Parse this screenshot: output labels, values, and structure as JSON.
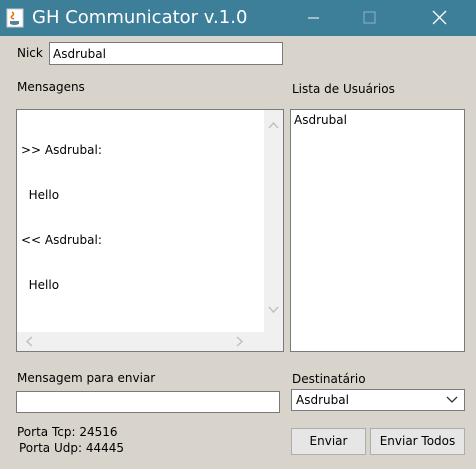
{
  "window": {
    "title": "GH Communicator v.1.0"
  },
  "nick": {
    "label": "Nick",
    "value": "Asdrubal"
  },
  "messages": {
    "label": "Mensagens",
    "lines": [
      ">> Asdrubal:",
      "  Hello",
      "<< Asdrubal:",
      "  Hello"
    ]
  },
  "users": {
    "label": "Lista de Usuários",
    "items": [
      "Asdrubal"
    ]
  },
  "compose": {
    "label": "Mensagem para enviar",
    "value": ""
  },
  "recipient": {
    "label": "Destinatário",
    "selected": "Asdrubal"
  },
  "ports": {
    "tcp": "Porta Tcp: 24516",
    "udp": "Porta Udp: 44445"
  },
  "buttons": {
    "send": "Enviar",
    "send_all": "Enviar Todos"
  },
  "colors": {
    "titlebar": "#3d7e99",
    "window_bg": "#d8d4cc"
  }
}
